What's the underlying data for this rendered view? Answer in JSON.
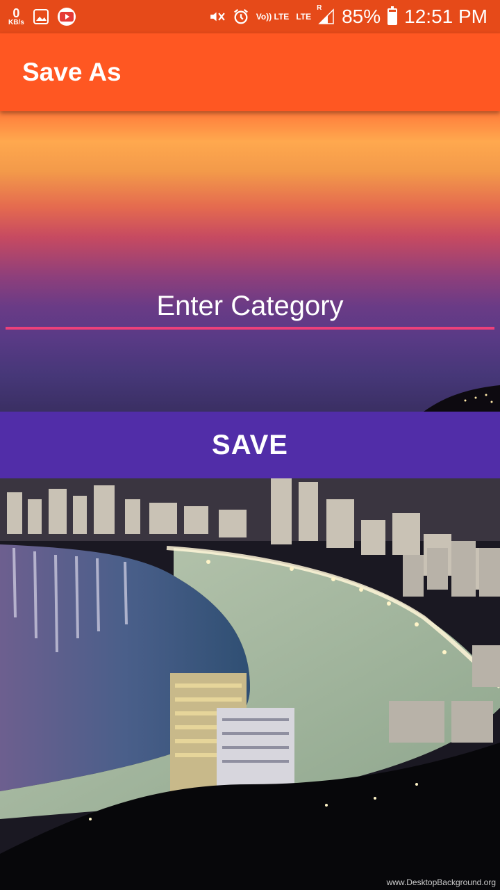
{
  "status_bar": {
    "net_speed_value": "0",
    "net_speed_unit": "KB/s",
    "volte_label": "Vo)) LTE",
    "lte_label": "LTE",
    "roaming_label": "R",
    "battery_percent": "85%",
    "time": "12:51 PM"
  },
  "app_bar": {
    "title": "Save As"
  },
  "form": {
    "category_placeholder": "Enter Category",
    "category_value": "",
    "save_label": "SAVE"
  },
  "background": {
    "watermark": "www.DesktopBackground.org"
  },
  "colors": {
    "status_bar": "#e64a19",
    "app_bar": "#ff5722",
    "save_button": "#512da8",
    "input_underline": "#ec407a"
  },
  "icons": [
    "gallery-icon",
    "youtube-icon",
    "mute-icon",
    "alarm-icon",
    "signal-icon",
    "battery-icon"
  ]
}
